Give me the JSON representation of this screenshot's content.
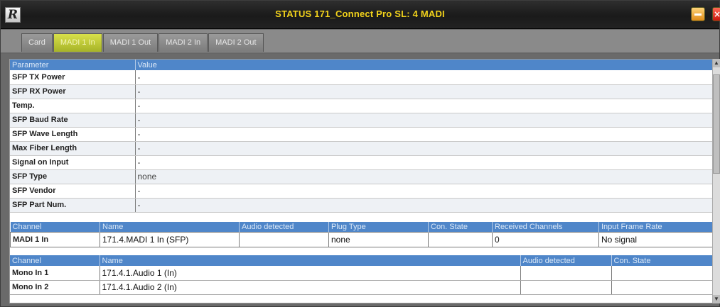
{
  "window": {
    "title": "STATUS 171_Connect Pro SL: 4 MADI",
    "logo_letter": "R",
    "close_glyph": "×"
  },
  "tabs": [
    {
      "label": "Card",
      "active": false
    },
    {
      "label": "MADI 1 In",
      "active": true
    },
    {
      "label": "MADI 1 Out",
      "active": false
    },
    {
      "label": "MADI 2 In",
      "active": false
    },
    {
      "label": "MADI 2 Out",
      "active": false
    }
  ],
  "params_table": {
    "headers": [
      "Parameter",
      "Value"
    ],
    "rows": [
      {
        "name": "SFP TX Power",
        "value": "-"
      },
      {
        "name": "SFP RX Power",
        "value": "-"
      },
      {
        "name": "Temp.",
        "value": "-"
      },
      {
        "name": "SFP Baud Rate",
        "value": "-"
      },
      {
        "name": "SFP Wave Length",
        "value": "-"
      },
      {
        "name": "Max Fiber Length",
        "value": "-"
      },
      {
        "name": "Signal on Input",
        "value": "-"
      },
      {
        "name": "SFP Type",
        "value": "none"
      },
      {
        "name": "SFP Vendor",
        "value": "-"
      },
      {
        "name": "SFP Part Num.",
        "value": "-"
      }
    ]
  },
  "channel_table": {
    "headers": [
      "Channel",
      "Name",
      "Audio detected",
      "Plug Type",
      "Con. State",
      "Received Channels",
      "Input Frame Rate"
    ],
    "rows": [
      [
        "MADI 1 In",
        "171.4.MADI 1 In (SFP)",
        "",
        "none",
        "",
        "0",
        "No signal"
      ]
    ]
  },
  "audio_table": {
    "headers": [
      "Channel",
      "Name",
      "Audio detected",
      "Con. State"
    ],
    "rows": [
      [
        "Mono In 1",
        "171.4.1.Audio 1 (In)",
        "",
        ""
      ],
      [
        "Mono In 2",
        "171.4.1.Audio 2 (In)",
        "",
        ""
      ]
    ]
  },
  "icons": {
    "minimize": "minimize-icon",
    "close": "close-icon",
    "scroll_up": "▲",
    "scroll_down": "▼"
  },
  "colors": {
    "title_text": "#f2d21b",
    "header_blue": "#4f86c9",
    "active_tab": "#c2cc38"
  }
}
